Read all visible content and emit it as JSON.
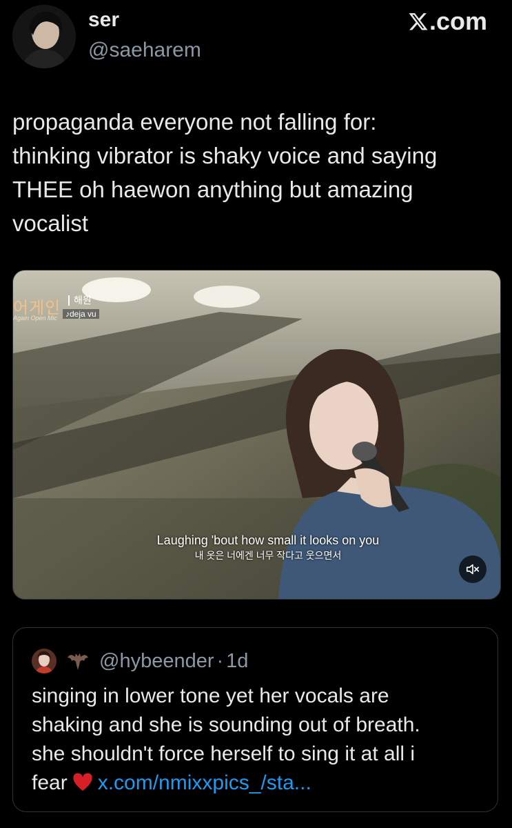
{
  "author": {
    "display_name": "ser",
    "handle": "@saeharem"
  },
  "brand": {
    "label": ".com"
  },
  "tweet": {
    "line1": "propaganda everyone not falling for:",
    "line2": "thinking vibrator is shaky voice and saying",
    "line3": "THEE oh haewon anything but amazing",
    "line4": "vocalist"
  },
  "media": {
    "show_logo": "어게인",
    "show_sub": "Again Open Mic",
    "singer": "해원",
    "song": "♪deja vu",
    "subtitle_en": "Laughing 'bout how small it looks on you",
    "subtitle_ko": "내 옷은 너에겐 너무 작다고 웃으면서",
    "mute_icon": "speaker-muted-icon"
  },
  "quote": {
    "handle": "@hybeender",
    "separator": "·",
    "time": "1d",
    "line1": "singing in lower tone yet her vocals are",
    "line2": "shaking and she is sounding out of breath.",
    "line3": "she shouldn't force herself to sing it at all i",
    "line4_prefix": "fear",
    "link": "x.com/nmixxpics_/sta..."
  },
  "colors": {
    "background": "#000000",
    "text": "#e7e9ea",
    "muted": "#8b98a5",
    "link": "#1d9bf0",
    "heart": "#d61f26"
  }
}
